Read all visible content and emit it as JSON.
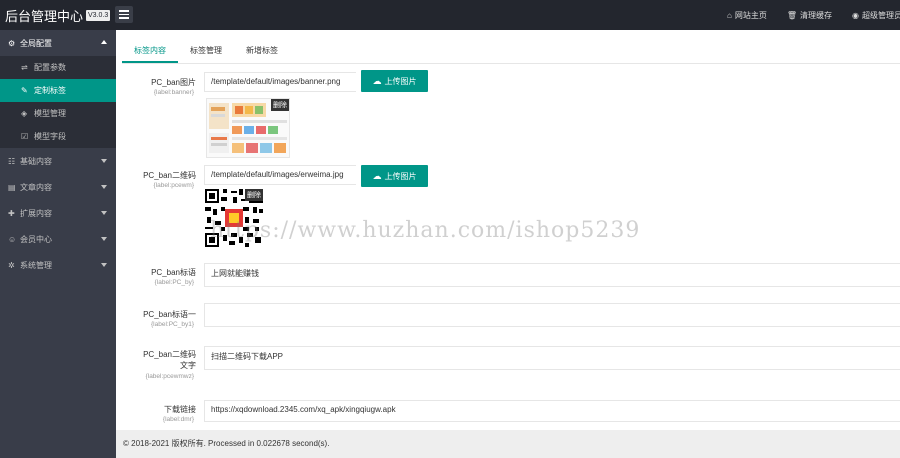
{
  "header": {
    "title": "后台管理中心",
    "version": "V3.0.3",
    "links": [
      {
        "icon": "home-icon",
        "label": "网站主页"
      },
      {
        "icon": "trash-icon",
        "label": "清理缓存"
      },
      {
        "icon": "user-icon",
        "label": "超级管理员"
      }
    ]
  },
  "sidebar": {
    "groups": [
      {
        "label": "全局配置",
        "icon": "gear-icon",
        "open": true,
        "items": [
          {
            "label": "配置参数",
            "icon": "sliders-icon"
          },
          {
            "label": "定制标签",
            "icon": "wrench-icon",
            "active": true
          },
          {
            "label": "模型管理",
            "icon": "cube-icon"
          },
          {
            "label": "模型字段",
            "icon": "edit-icon"
          }
        ]
      },
      {
        "label": "基础内容",
        "icon": "sitemap-icon"
      },
      {
        "label": "文章内容",
        "icon": "file-icon"
      },
      {
        "label": "扩展内容",
        "icon": "puzzle-icon"
      },
      {
        "label": "会员中心",
        "icon": "user-icon"
      },
      {
        "label": "系统管理",
        "icon": "gear-icon"
      }
    ]
  },
  "tabs": [
    "标签内容",
    "标签管理",
    "新增标签"
  ],
  "form": {
    "banner": {
      "label": "PC_ban图片",
      "tag": "{label:banner}",
      "value": "/template/default/images/banner.png",
      "button": "上传图片",
      "delete": "删除"
    },
    "qrcode": {
      "label": "PC_ban二维码",
      "tag": "{label:pcewm}",
      "value": "/template/default/images/erweima.jpg",
      "button": "上传图片",
      "delete": "删除"
    },
    "title": {
      "label": "PC_ban标语",
      "tag": "{label:PC_by}",
      "value": "上网就能赚钱"
    },
    "title1": {
      "label": "PC_ban标语一",
      "tag": "{label:PC_by1}",
      "value": ""
    },
    "qrtext": {
      "label1": "PC_ban二维码",
      "label2": "文字",
      "tag": "{label:pcewmwz}",
      "value": "扫描二维码下载APP"
    },
    "download": {
      "label": "下载链接",
      "tag": "{label:dmr}",
      "value": "https://xqdownload.2345.com/xq_apk/xingqiugw.apk"
    }
  },
  "footer": {
    "text": "© 2018-2021 版权所有. Processed in 0.022678 second(s)."
  },
  "watermark": "https://www.huzhan.com/ishop5239",
  "colors": {
    "accent": "#009688",
    "topbar": "#23262e",
    "sidebar": "#393d49"
  }
}
